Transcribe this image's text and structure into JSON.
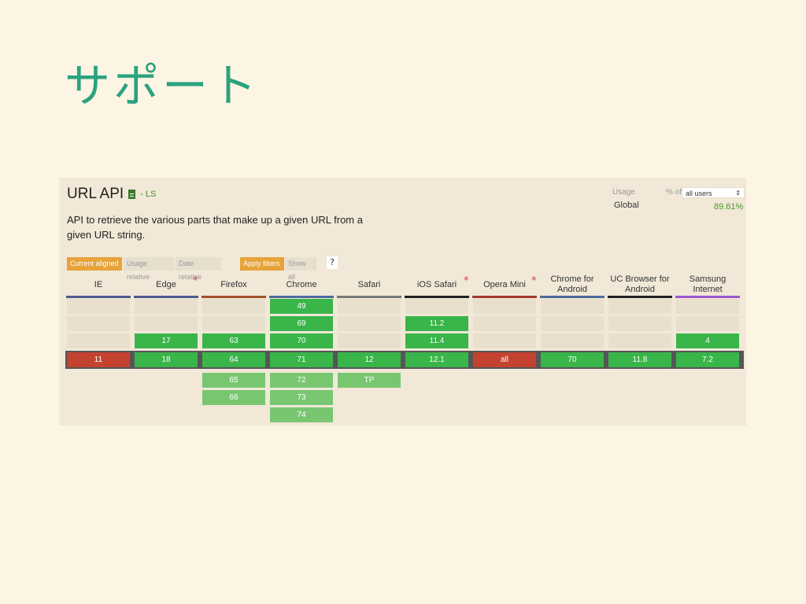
{
  "slide": {
    "title": "サポート"
  },
  "feature": {
    "title": "URL API",
    "status": "- LS",
    "description": "API to retrieve the various parts that make up a given URL from a given URL string."
  },
  "usage": {
    "label": "Usage",
    "pct_of": "% of",
    "select_value": "all users",
    "global_label": "Global",
    "global_value": "89.61%"
  },
  "controls": {
    "current_aligned": "Current aligned",
    "usage_relative": "Usage relative",
    "date_relative": "Date relative",
    "apply_filters": "Apply filters",
    "show_all": "Show all",
    "help": "?"
  },
  "colors": {
    "supported": "#39b54a",
    "supported_future": "#79c671",
    "unsupported": "#c44230",
    "empty": "#e8dfcd"
  },
  "browsers": [
    {
      "name": "IE",
      "bar": "#4b5b8a",
      "asterisk": false,
      "past": [
        "",
        "",
        ""
      ],
      "current": {
        "v": "11",
        "s": "n"
      },
      "future": [
        "",
        "",
        ""
      ]
    },
    {
      "name": "Edge",
      "bar": "#4b5b8a",
      "asterisk": true,
      "past": [
        "",
        "",
        "17"
      ],
      "current": {
        "v": "18",
        "s": "y"
      },
      "future": [
        "",
        "",
        ""
      ]
    },
    {
      "name": "Firefox",
      "bar": "#a2522a",
      "asterisk": false,
      "past": [
        "",
        "",
        "63"
      ],
      "current": {
        "v": "64",
        "s": "y"
      },
      "future": [
        "65",
        "66",
        ""
      ]
    },
    {
      "name": "Chrome",
      "bar": "#4b6b9a",
      "asterisk": false,
      "past": [
        "49",
        "69",
        "70"
      ],
      "current": {
        "v": "71",
        "s": "y"
      },
      "future": [
        "72",
        "73",
        "74"
      ]
    },
    {
      "name": "Safari",
      "bar": "#777777",
      "asterisk": false,
      "past": [
        "",
        "",
        ""
      ],
      "current": {
        "v": "12",
        "s": "y"
      },
      "future": [
        "TP",
        "",
        ""
      ]
    },
    {
      "name": "iOS Safari",
      "bar": "#222222",
      "asterisk": true,
      "past": [
        "",
        "11.2",
        "11.4"
      ],
      "current": {
        "v": "12.1",
        "s": "y"
      },
      "future": [
        "",
        "",
        ""
      ]
    },
    {
      "name": "Opera Mini",
      "bar": "#a43a2a",
      "asterisk": true,
      "past": [
        "",
        "",
        ""
      ],
      "current": {
        "v": "all",
        "s": "n"
      },
      "future": [
        "",
        "",
        ""
      ]
    },
    {
      "name": "Chrome for Android",
      "bar": "#4b6b9a",
      "asterisk": false,
      "past": [
        "",
        "",
        ""
      ],
      "current": {
        "v": "70",
        "s": "y"
      },
      "future": [
        "",
        "",
        ""
      ]
    },
    {
      "name": "UC Browser for Android",
      "bar": "#222222",
      "asterisk": false,
      "past": [
        "",
        "",
        ""
      ],
      "current": {
        "v": "11.8",
        "s": "y"
      },
      "future": [
        "",
        "",
        ""
      ]
    },
    {
      "name": "Samsung Internet",
      "bar": "#9b55cf",
      "asterisk": false,
      "past": [
        "",
        "",
        "4"
      ],
      "current": {
        "v": "7.2",
        "s": "y"
      },
      "future": [
        "",
        "",
        ""
      ]
    }
  ]
}
